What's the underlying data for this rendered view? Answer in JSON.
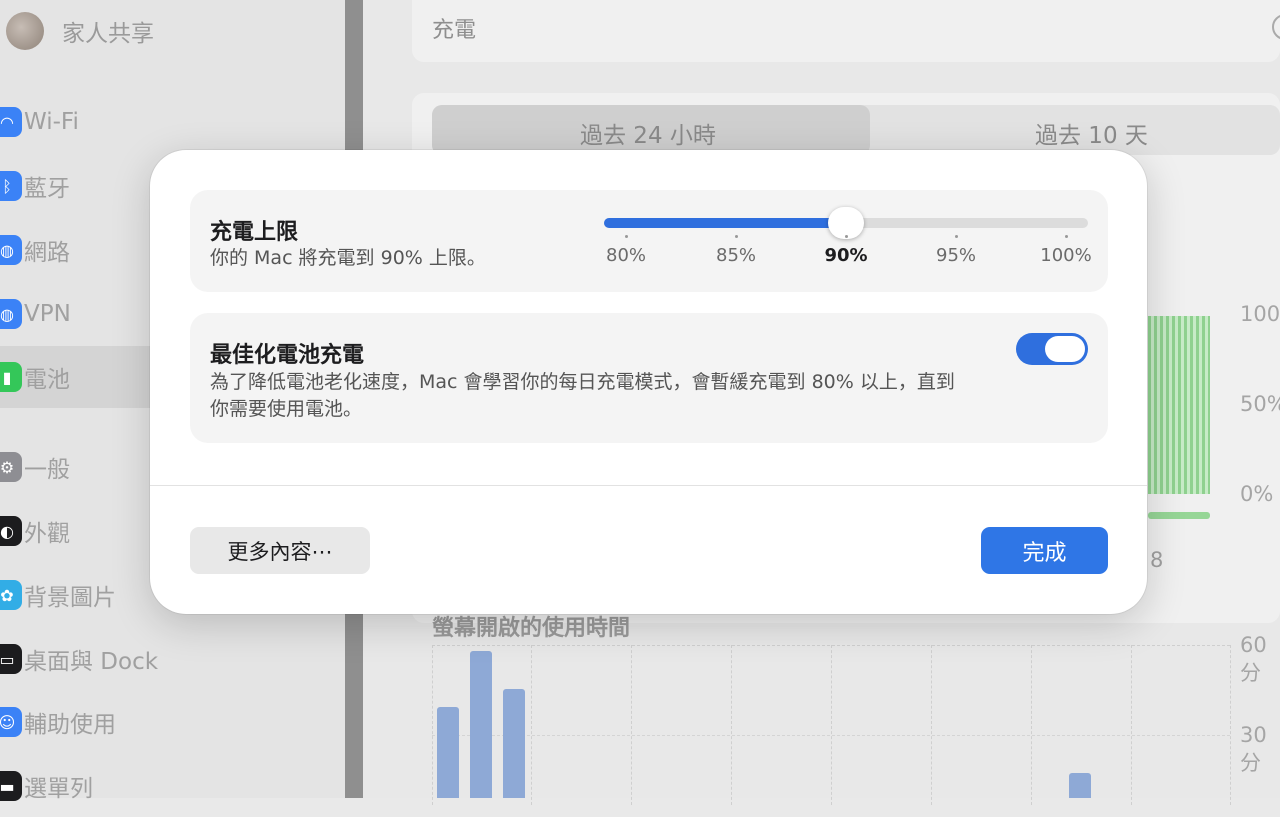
{
  "sidebar": {
    "family_label": "家人共享",
    "items": [
      {
        "label": "Wi-Fi",
        "icon": "wifi-icon",
        "color": "#3b82f6"
      },
      {
        "label": "藍牙",
        "icon": "bluetooth-icon",
        "color": "#3b82f6"
      },
      {
        "label": "網路",
        "icon": "globe-icon",
        "color": "#3b82f6"
      },
      {
        "label": "VPN",
        "icon": "vpn-icon",
        "color": "#3b82f6"
      },
      {
        "label": "電池",
        "icon": "battery-icon",
        "color": "#34c759"
      },
      {
        "label": "一般",
        "icon": "gear-icon",
        "color": "#8e8e93"
      },
      {
        "label": "外觀",
        "icon": "appearance-icon",
        "color": "#1c1c1e"
      },
      {
        "label": "背景圖片",
        "icon": "wallpaper-icon",
        "color": "#32ade6"
      },
      {
        "label": "桌面與 Dock",
        "icon": "dock-icon",
        "color": "#1c1c1e"
      },
      {
        "label": "輔助使用",
        "icon": "accessibility-icon",
        "color": "#3b82f6"
      },
      {
        "label": "選單列",
        "icon": "menubar-icon",
        "color": "#1c1c1e"
      }
    ]
  },
  "main": {
    "section_title": "充電",
    "tabs": [
      "過去 24 小時",
      "過去 10 天"
    ],
    "selected_tab": 0,
    "battery_axis": [
      "100",
      "50%",
      "0%"
    ],
    "x_tail": "8",
    "usage_title": "螢幕開啟的使用時間",
    "usage_axis": [
      "60 分",
      "30 分"
    ]
  },
  "dialog": {
    "charge_limit": {
      "title": "充電上限",
      "description": "你的 Mac 將充電到 90% 上限。",
      "ticks": [
        "80%",
        "85%",
        "90%",
        "95%",
        "100%"
      ],
      "selected_index": 2
    },
    "optimized": {
      "title": "最佳化電池充電",
      "description": "為了降低電池老化速度，Mac 會學習你的每日充電模式，會暫緩充電到 80% 以上，直到你需要使用電池。",
      "enabled": true
    },
    "more_button": "更多內容⋯",
    "done_button": "完成"
  },
  "colors": {
    "accent": "#2f6fde",
    "done_button": "#2f76e6",
    "battery_green": "#8fd18f"
  }
}
